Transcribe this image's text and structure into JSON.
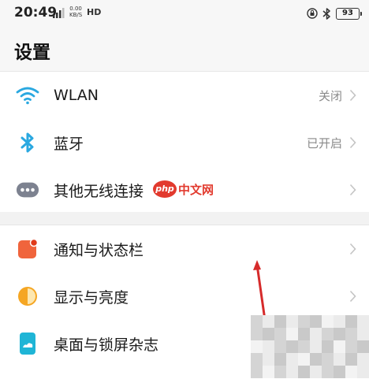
{
  "status_bar": {
    "time": "20:49",
    "speed_value": "0.00",
    "speed_unit": "KB/S",
    "hd": "HD",
    "battery": "93",
    "signal_icon": "signal-icon",
    "lock_icon": "rotation-lock-icon",
    "bluetooth_icon": "bluetooth-icon"
  },
  "header": {
    "title": "设置"
  },
  "group1": {
    "items": [
      {
        "label": "WLAN",
        "value": "关闭",
        "icon": "wifi-icon"
      },
      {
        "label": "蓝牙",
        "value": "已开启",
        "icon": "bluetooth-icon"
      },
      {
        "label": "其他无线连接",
        "value": "",
        "icon": "more-connections-icon"
      }
    ]
  },
  "group2": {
    "items": [
      {
        "label": "通知与状态栏",
        "icon": "notification-icon"
      },
      {
        "label": "显示与亮度",
        "icon": "display-brightness-icon"
      },
      {
        "label": "桌面与锁屏杂志",
        "icon": "desktop-lockscreen-icon"
      }
    ]
  },
  "watermark": {
    "badge": "php",
    "text": "中文网"
  },
  "colors": {
    "accent_blue": "#2aa8e0",
    "notification_orange": "#f0643c",
    "display_orange": "#f5a623",
    "wallpaper_teal": "#1fb5d6",
    "gray_icon": "#7d8290",
    "watermark_red": "#e23a2e"
  }
}
